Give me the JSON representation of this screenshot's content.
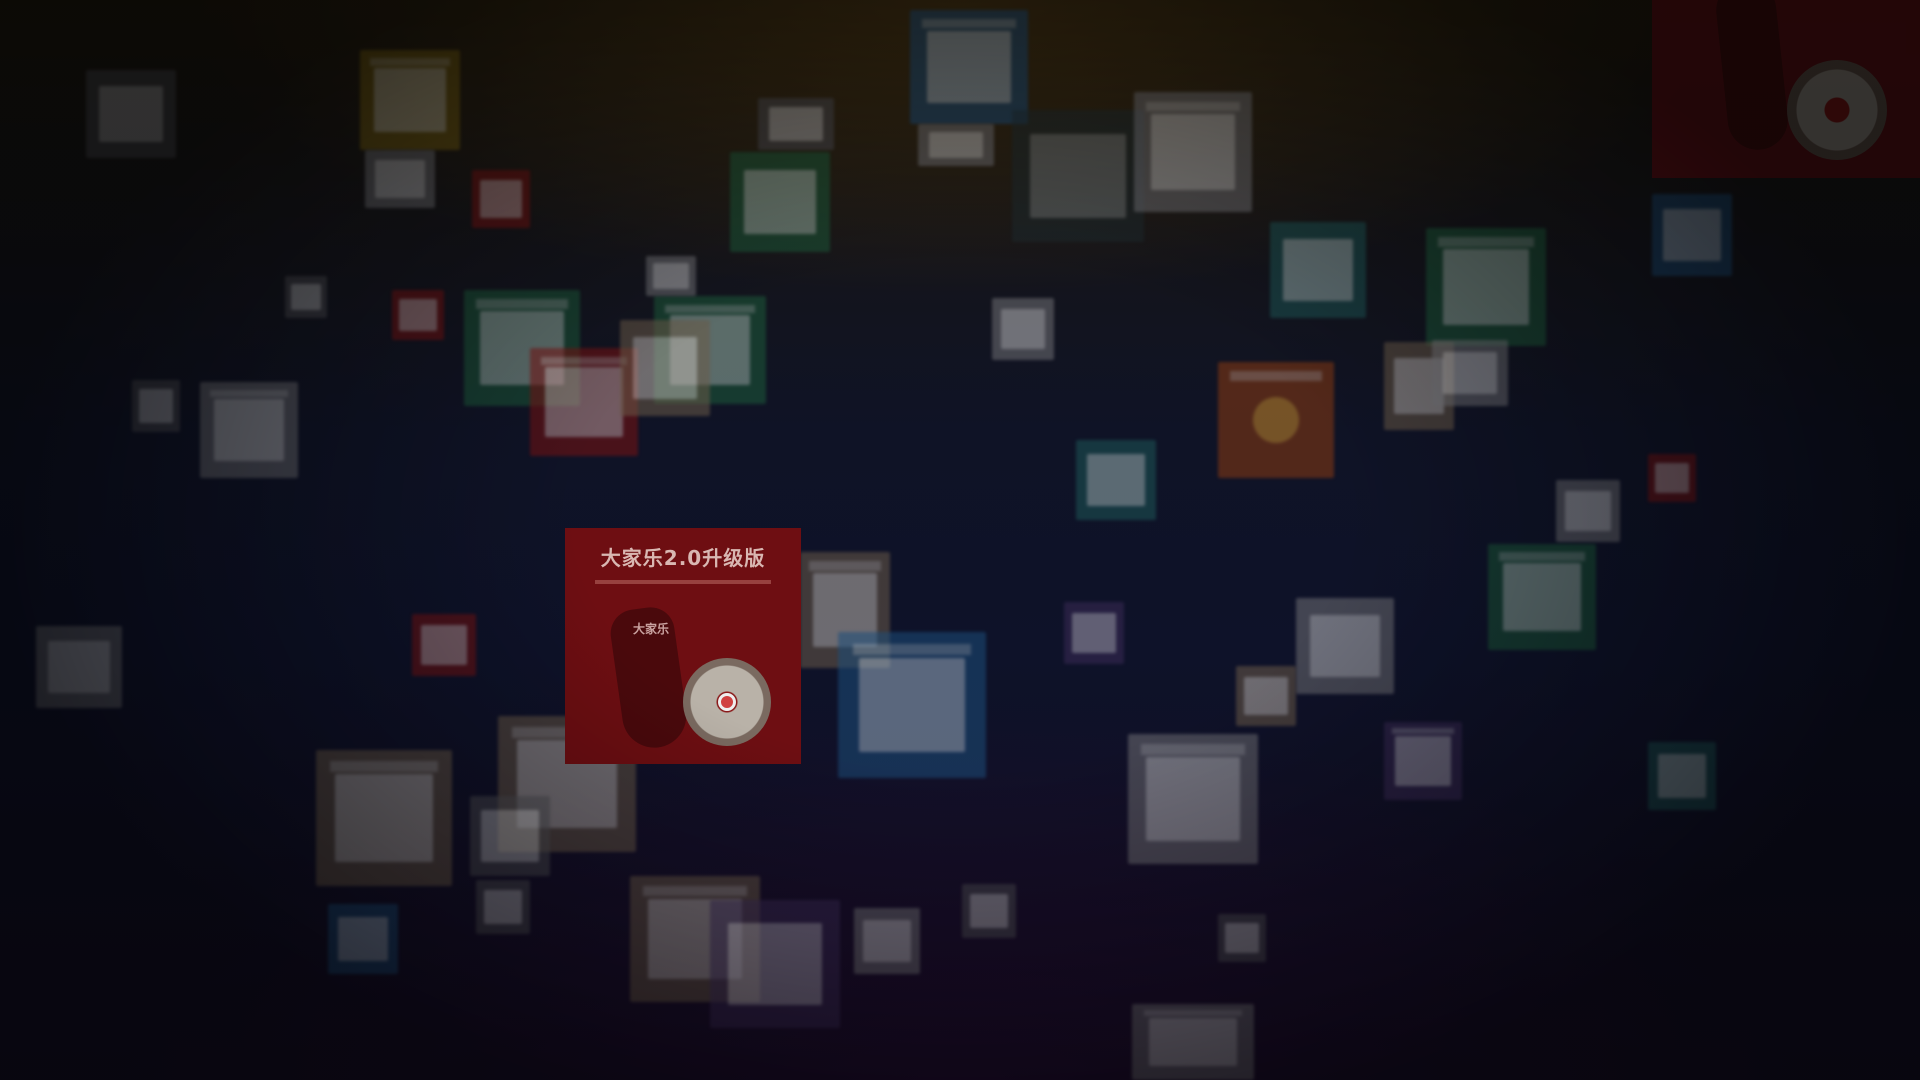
{
  "scene": {
    "name": "thumbnail-wall-background",
    "featured_card": {
      "title": "大家乐2.0升级版",
      "phone_label": "大家乐"
    }
  },
  "colors": {
    "background_top": "#1b160b",
    "background_mid": "#0f1326",
    "background_bottom": "#120d22",
    "featured_red": "#6e0e12"
  }
}
